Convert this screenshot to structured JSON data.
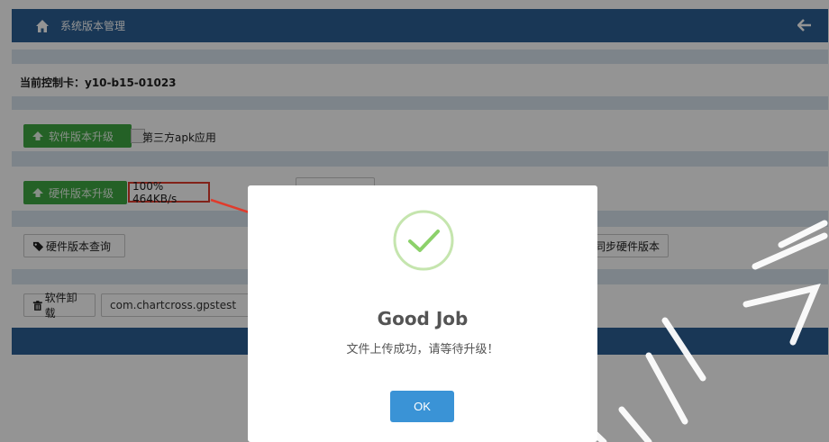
{
  "topbar": {
    "title": "系统版本管理",
    "home_icon": "home-icon",
    "back_icon": "arrow-left-icon"
  },
  "controller": {
    "label": "当前控制卡：y10-b15-01023"
  },
  "software_upgrade": {
    "button_label": "软件版本升级",
    "checkbox_label": "第三方apk应用"
  },
  "hardware_upgrade": {
    "button_label": "硬件版本升级",
    "progress_text": "100% 464KB/s"
  },
  "hardware_query": {
    "button_label": "硬件版本查询",
    "sync_label": "同步硬件版本"
  },
  "uninstall": {
    "button_label": "软件卸载",
    "package": "com.chartcross.gpstest"
  },
  "modal": {
    "title": "Good Job",
    "message": "文件上传成功，请等待升级！",
    "ok_label": "OK"
  },
  "colors": {
    "accent": "#2b5f94",
    "green": "#3fa742",
    "ok": "#3a93d6",
    "highlight": "#e03b2c"
  }
}
